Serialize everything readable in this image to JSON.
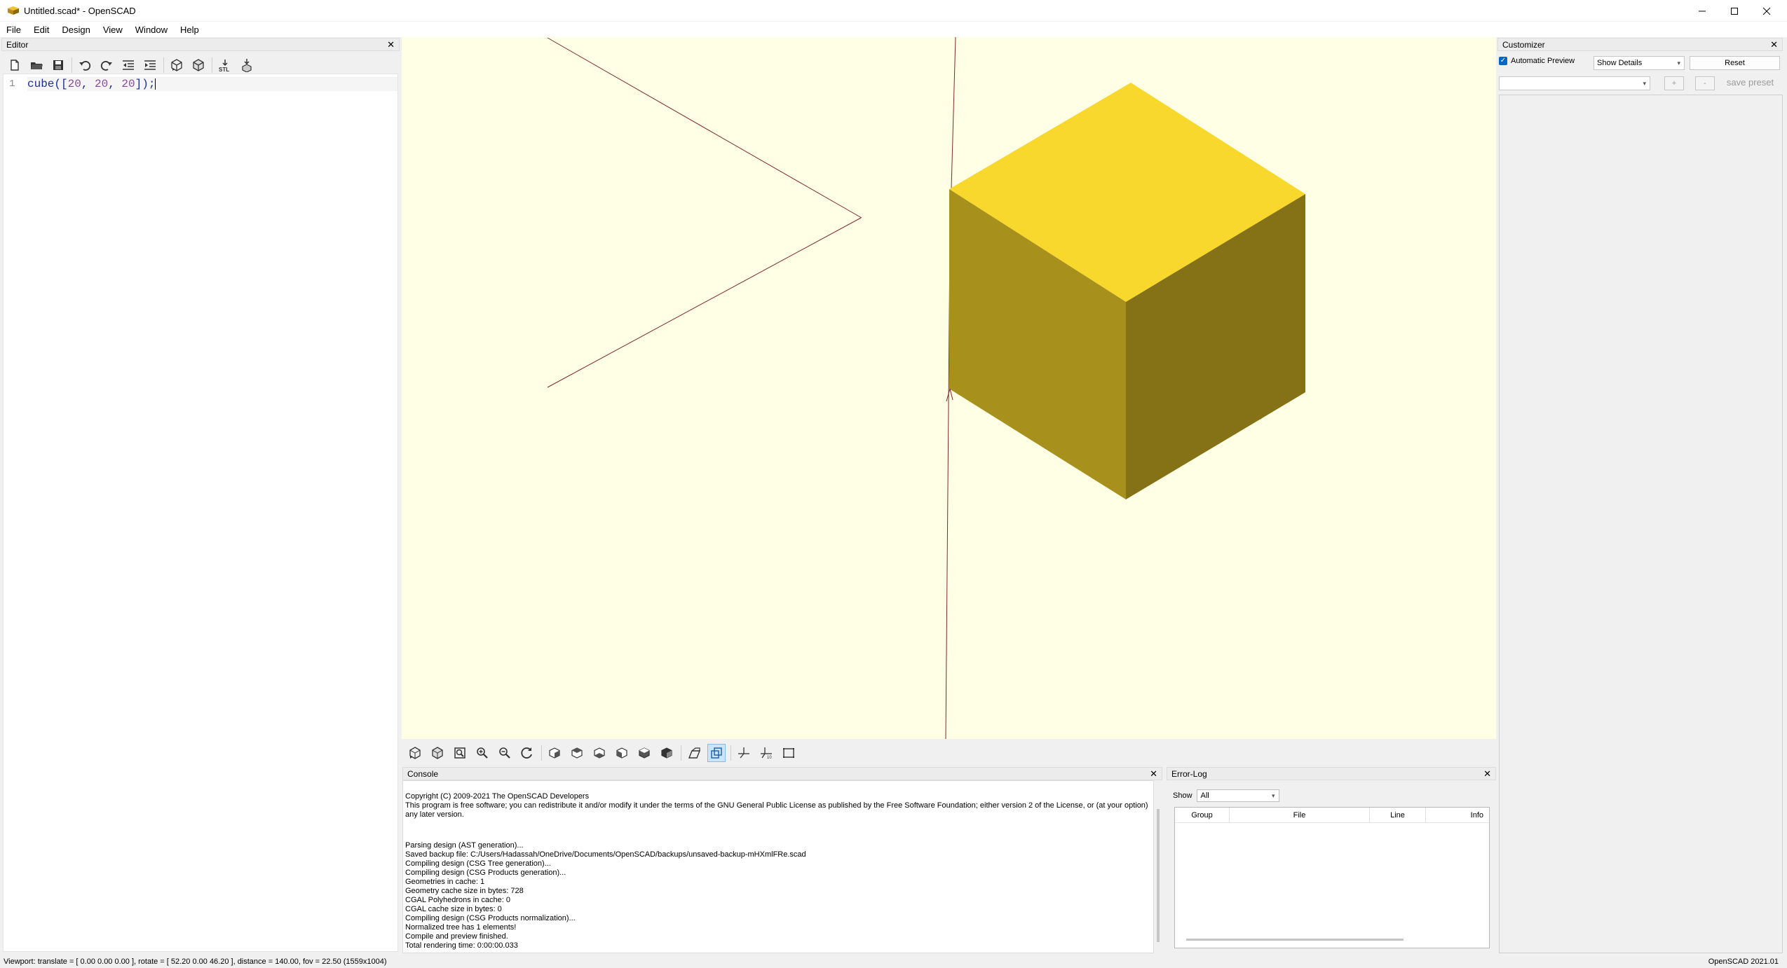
{
  "window": {
    "title": "Untitled.scad* - OpenSCAD",
    "controls": [
      "minimize",
      "maximize",
      "close"
    ]
  },
  "menu": [
    "File",
    "Edit",
    "Design",
    "View",
    "Window",
    "Help"
  ],
  "editor": {
    "panel_title": "Editor",
    "toolbar_icons": [
      "new-file-icon",
      "open-file-icon",
      "save-icon",
      "undo-icon",
      "redo-icon",
      "unindent-icon",
      "indent-icon",
      "preview-icon",
      "render-icon",
      "export-stl-icon",
      "send-to-printer-icon"
    ],
    "export_label": "STL",
    "line_number": "1",
    "code_segments": {
      "fn": "cube",
      "open": "([",
      "n1": "20",
      "comma1": ", ",
      "n2": "20",
      "comma2": ", ",
      "n3": "20",
      "close": "]);"
    }
  },
  "viewport": {
    "object": "cube",
    "colors": {
      "background": "#ffffe5",
      "top_face": "#f8d82d",
      "left_face": "#a8901d",
      "right_face": "#857217",
      "axes": "#7a2b2b"
    },
    "toolbar_icons": [
      "preview-icon",
      "render-icon",
      "view-all-icon",
      "zoom-in-icon",
      "zoom-out-icon",
      "reset-view-icon",
      "view-right-icon",
      "view-top-icon",
      "view-bottom-icon",
      "view-left-icon",
      "view-front-icon",
      "view-back-icon",
      "perspective-icon",
      "orthogonal-icon",
      "show-axes-icon",
      "show-scale-markers-icon",
      "show-edges-icon"
    ]
  },
  "console": {
    "panel_title": "Console",
    "lines": [
      "Copyright (C) 2009-2021 The OpenSCAD Developers",
      "This program is free software; you can redistribute it and/or modify it under the terms of the GNU General Public License as published by the Free Software Foundation; either version 2 of the License, or (at your option)",
      "any later version.",
      "",
      "",
      "Parsing design (AST generation)...",
      "Saved backup file: C:/Users/Hadassah/OneDrive/Documents/OpenSCAD/backups/unsaved-backup-mHXmlFRe.scad",
      "Compiling design (CSG Tree generation)...",
      "Compiling design (CSG Products generation)...",
      "Geometries in cache: 1",
      "Geometry cache size in bytes: 728",
      "CGAL Polyhedrons in cache: 0",
      "CGAL cache size in bytes: 0",
      "Compiling design (CSG Products normalization)...",
      "Normalized tree has 1 elements!",
      "Compile and preview finished.",
      "Total rendering time: 0:00:00.033"
    ]
  },
  "error_log": {
    "panel_title": "Error-Log",
    "show_label": "Show",
    "show_value": "All",
    "columns": [
      "Group",
      "File",
      "Line",
      "Info"
    ]
  },
  "customizer": {
    "panel_title": "Customizer",
    "automatic_preview_label": "Automatic Preview",
    "automatic_preview_checked": true,
    "details_value": "Show Details",
    "reset_label": "Reset",
    "preset_value": "",
    "add_label": "+",
    "remove_label": "-",
    "save_preset_label": "save preset"
  },
  "statusbar": {
    "viewport_info": "Viewport: translate = [ 0.00 0.00 0.00 ], rotate = [ 52.20 0.00 46.20 ], distance = 140.00, fov = 22.50 (1559x1004)",
    "version": "OpenSCAD 2021.01"
  }
}
